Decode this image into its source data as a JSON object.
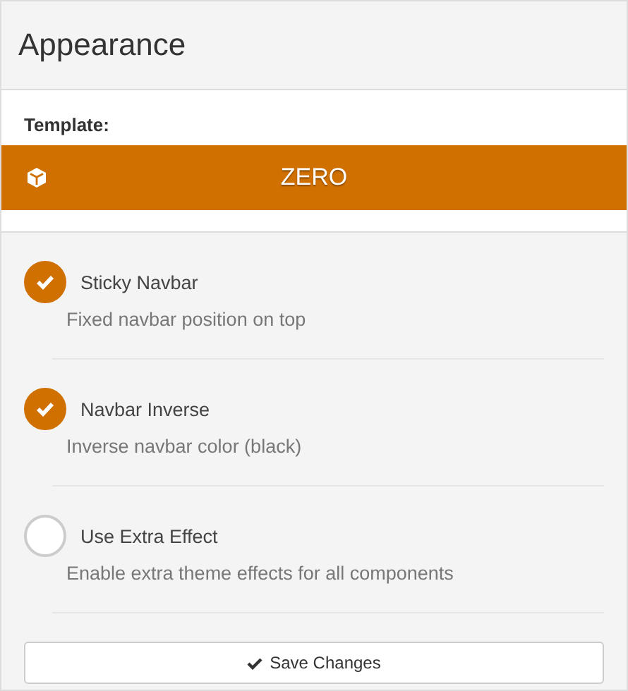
{
  "panel": {
    "title": "Appearance"
  },
  "template": {
    "label": "Template:",
    "value": "ZERO"
  },
  "options": [
    {
      "label": "Sticky Navbar",
      "description": "Fixed navbar position on top",
      "checked": true
    },
    {
      "label": "Navbar Inverse",
      "description": "Inverse navbar color (black)",
      "checked": true
    },
    {
      "label": "Use Extra Effect",
      "description": "Enable extra theme effects for all components",
      "checked": false
    }
  ],
  "save_button": {
    "label": "Save Changes"
  }
}
